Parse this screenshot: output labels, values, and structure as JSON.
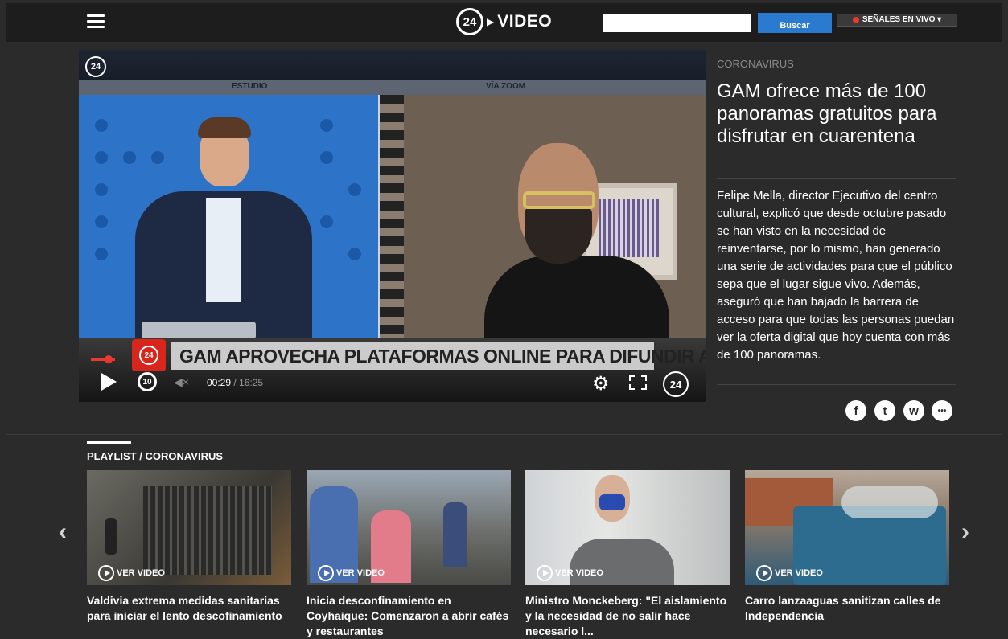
{
  "header": {
    "logo_badge": "24",
    "logo_text": "VIDEO",
    "search_placeholder": "",
    "search_button": "Buscar",
    "live_button": "SEÑALES EN VIVO ▾"
  },
  "player": {
    "corner_badge": "24",
    "label_left": "ESTUDIO",
    "label_right": "VÍA ZOOM",
    "lower_third_badge": "24",
    "lower_third_text": "GAM APROVECHA PLATAFORMAS ONLINE PARA DIFUNDIR ARTE",
    "replay_label": "10",
    "time_current": "00:29",
    "time_duration": "/ 16:25",
    "brand_label": "24",
    "progress_fraction": 0.03
  },
  "article": {
    "category": "CORONAVIRUS",
    "headline": "GAM ofrece más de 100 panoramas gratuitos para disfrutar en cuarentena",
    "summary": "Felipe Mella, director Ejecutivo del centro cultural, explicó que desde octubre pasado se han visto en la necesidad de reinventarse, por lo mismo, han generado una serie de actividades para que el público sepa que el lugar sigue vivo. Además, aseguró que han bajado la barrera de acceso para que todas las personas puedan ver la oferta digital que hoy cuenta con más de 100 panoramas."
  },
  "share": {
    "facebook": "f",
    "twitter": "t",
    "whatsapp": "w",
    "more": "•••"
  },
  "playlist": {
    "title": "PLAYLIST / CORONAVIRUS",
    "prev": "‹",
    "next": "›",
    "items": [
      {
        "cta": "VER VIDEO",
        "title": "Valdivia extrema medidas sanitarias para iniciar el lento descofinamiento"
      },
      {
        "cta": "VER VIDEO",
        "title": "Inicia desconfinamiento en Coyhaique: Comenzaron a abrir cafés y restaurantes"
      },
      {
        "cta": "VER VIDEO",
        "title": "Ministro Monckeberg: \"El aislamiento y la necesidad de no salir hace necesario l..."
      },
      {
        "cta": "VER VIDEO",
        "title": "Carro lanzaaguas sanitizan calles de Independencia"
      }
    ]
  },
  "colors": {
    "accent": "#2a7bd0",
    "live": "#e8392c",
    "background": "#2b2b2b"
  }
}
